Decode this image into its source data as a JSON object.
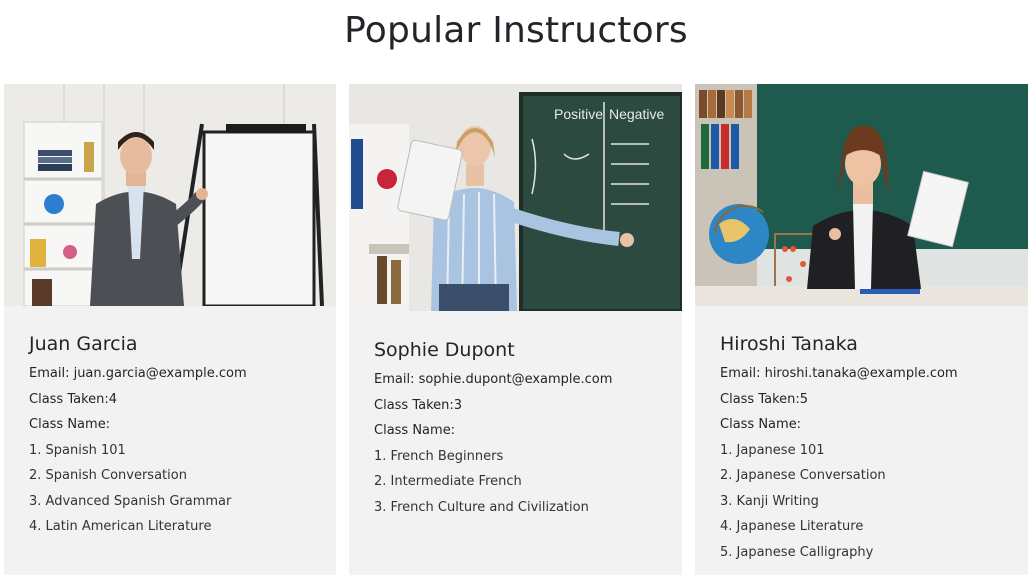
{
  "page": {
    "title": "Popular Instructors"
  },
  "instructors": [
    {
      "name": "Juan Garcia",
      "email_label": "Email: juan.garcia@example.com",
      "classes_taken": "Class Taken:4",
      "class_name_label": "Class Name:",
      "classes": [
        "1. Spanish 101",
        "2. Spanish Conversation",
        "3. Advanced Spanish Grammar",
        "4. Latin American Literature"
      ]
    },
    {
      "name": "Sophie Dupont",
      "email_label": "Email: sophie.dupont@example.com",
      "classes_taken": "Class Taken:3",
      "class_name_label": "Class Name:",
      "classes": [
        "1. French Beginners",
        "2. Intermediate French",
        "3. French Culture and Civilization"
      ]
    },
    {
      "name": "Hiroshi Tanaka",
      "email_label": "Email: hiroshi.tanaka@example.com",
      "classes_taken": "Class Taken:5",
      "class_name_label": "Class Name:",
      "classes": [
        "1. Japanese 101",
        "2. Japanese Conversation",
        "3. Kanji Writing",
        "4. Japanese Literature",
        "5. Japanese Calligraphy"
      ]
    }
  ],
  "photo_labels": {
    "chalkboard_positive": "Positive",
    "chalkboard_negative": "Negative"
  }
}
